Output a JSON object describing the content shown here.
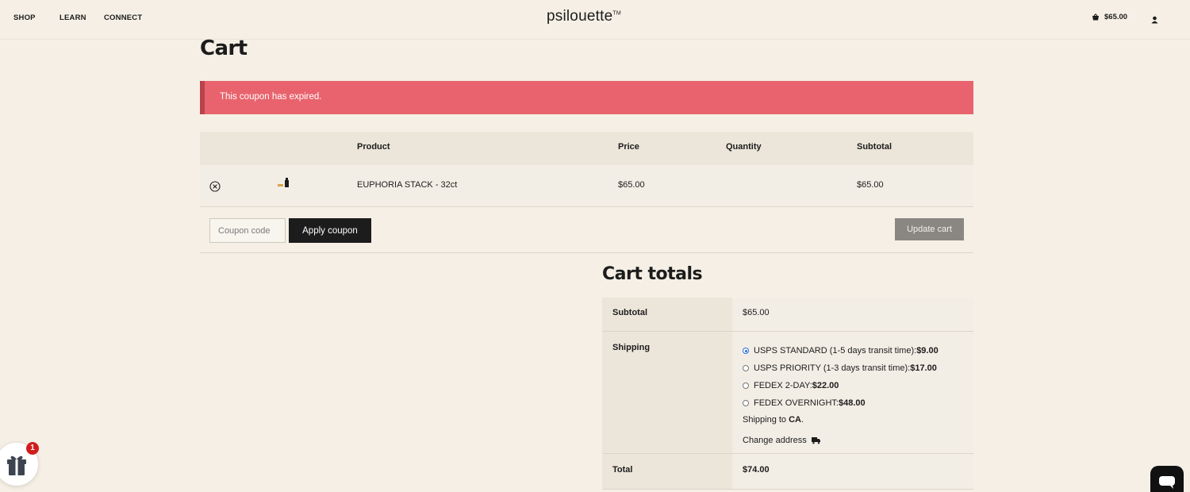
{
  "nav": {
    "items": [
      "SHOP",
      "LEARN",
      "CONNECT"
    ],
    "logo": "psilouette",
    "trademark": "TM",
    "cart_total": "$65.00"
  },
  "page": {
    "title": "Cart"
  },
  "notice": {
    "message": "This coupon has expired."
  },
  "cart": {
    "headers": {
      "product": "Product",
      "price": "Price",
      "quantity": "Quantity",
      "subtotal": "Subtotal"
    },
    "items": [
      {
        "product": "EUPHORIA STACK - 32ct",
        "price": "$65.00",
        "subtotal": "$65.00"
      }
    ]
  },
  "actions": {
    "coupon_placeholder": "Coupon code",
    "apply_label": "Apply coupon",
    "update_label": "Update cart"
  },
  "totals": {
    "title": "Cart totals",
    "subtotal_label": "Subtotal",
    "subtotal_value": "$65.00",
    "shipping_label": "Shipping",
    "shipping_options": [
      {
        "label": "USPS STANDARD (1-5 days transit time): ",
        "price": "$9.00",
        "selected": true
      },
      {
        "label": "USPS PRIORITY (1-3 days transit time): ",
        "price": "$17.00",
        "selected": false
      },
      {
        "label": "FEDEX 2-DAY: ",
        "price": "$22.00",
        "selected": false
      },
      {
        "label": "FEDEX OVERNIGHT: ",
        "price": "$48.00",
        "selected": false
      }
    ],
    "shipping_to_prefix": "Shipping to ",
    "shipping_to_region": "CA",
    "shipping_to_suffix": ".",
    "change_address_label": "Change address",
    "total_label": "Total",
    "total_value": "$74.00"
  },
  "widgets": {
    "gift_badge_count": "1"
  },
  "colors": {
    "background": "#f5efe5",
    "notice": "#e8636d",
    "accent": "#1c1c1c",
    "radio_selected": "#2a6fe0"
  }
}
